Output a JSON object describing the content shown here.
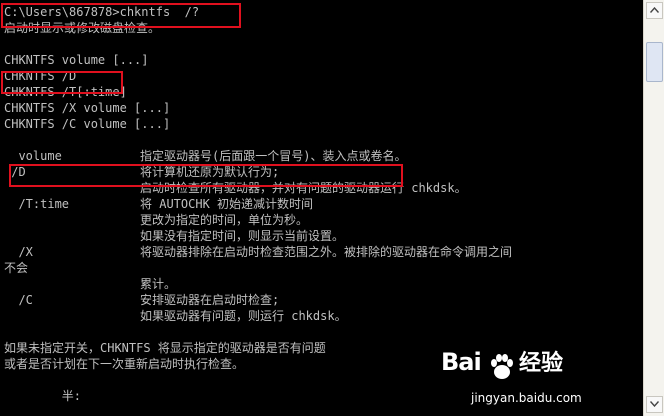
{
  "console": {
    "lines": [
      "C:\\Users\\867878>chkntfs  /?",
      "启动时显示或修改磁盘检查。",
      "",
      "CHKNTFS volume [...]",
      "CHKNTFS /D",
      "CHKNTFS /T[:time]",
      "CHKNTFS /X volume [...]",
      "CHKNTFS /C volume [...]",
      ""
    ],
    "options": [
      {
        "name": "  volume",
        "desc": "指定驱动器号(后面跟一个冒号)、装入点或卷名。"
      },
      {
        "name": " /D",
        "desc": "将计算机还原为默认行为;"
      },
      {
        "name": "",
        "desc": "启动时检查所有驱动器，并对有问题的驱动器运行 chkdsk。"
      },
      {
        "name": "  /T:time",
        "desc": "将 AUTOCHK 初始递减计数时间"
      },
      {
        "name": "",
        "desc": "更改为指定的时间，单位为秒。"
      },
      {
        "name": "",
        "desc": "如果没有指定时间，则显示当前设置。"
      },
      {
        "name": "  /X",
        "desc": "将驱动器排除在启动时检查范围之外。被排除的驱动器在命令调用之间"
      }
    ],
    "wrap_line": "不会",
    "options2": [
      {
        "name": "",
        "desc": "累计。"
      },
      {
        "name": "  /C",
        "desc": "安排驱动器在启动时检查;"
      },
      {
        "name": "",
        "desc": "如果驱动器有问题，则运行 chkdsk。"
      }
    ],
    "footer": [
      "",
      "如果未指定开关，CHKNTFS 将显示指定的驱动器是否有问题",
      "或者是否计划在下一次重新启动时执行检查。",
      "",
      "        半:"
    ]
  },
  "scrollbar": {
    "up_icon": "arrow-up-icon",
    "down_icon": "arrow-down-icon"
  },
  "watermark": {
    "logo": "Bai",
    "brand": "经验",
    "url": "jingyan.baidu.com"
  },
  "colors": {
    "console_bg": "#000000",
    "console_fg": "#c0c0c0",
    "highlight": "#e0101e"
  }
}
